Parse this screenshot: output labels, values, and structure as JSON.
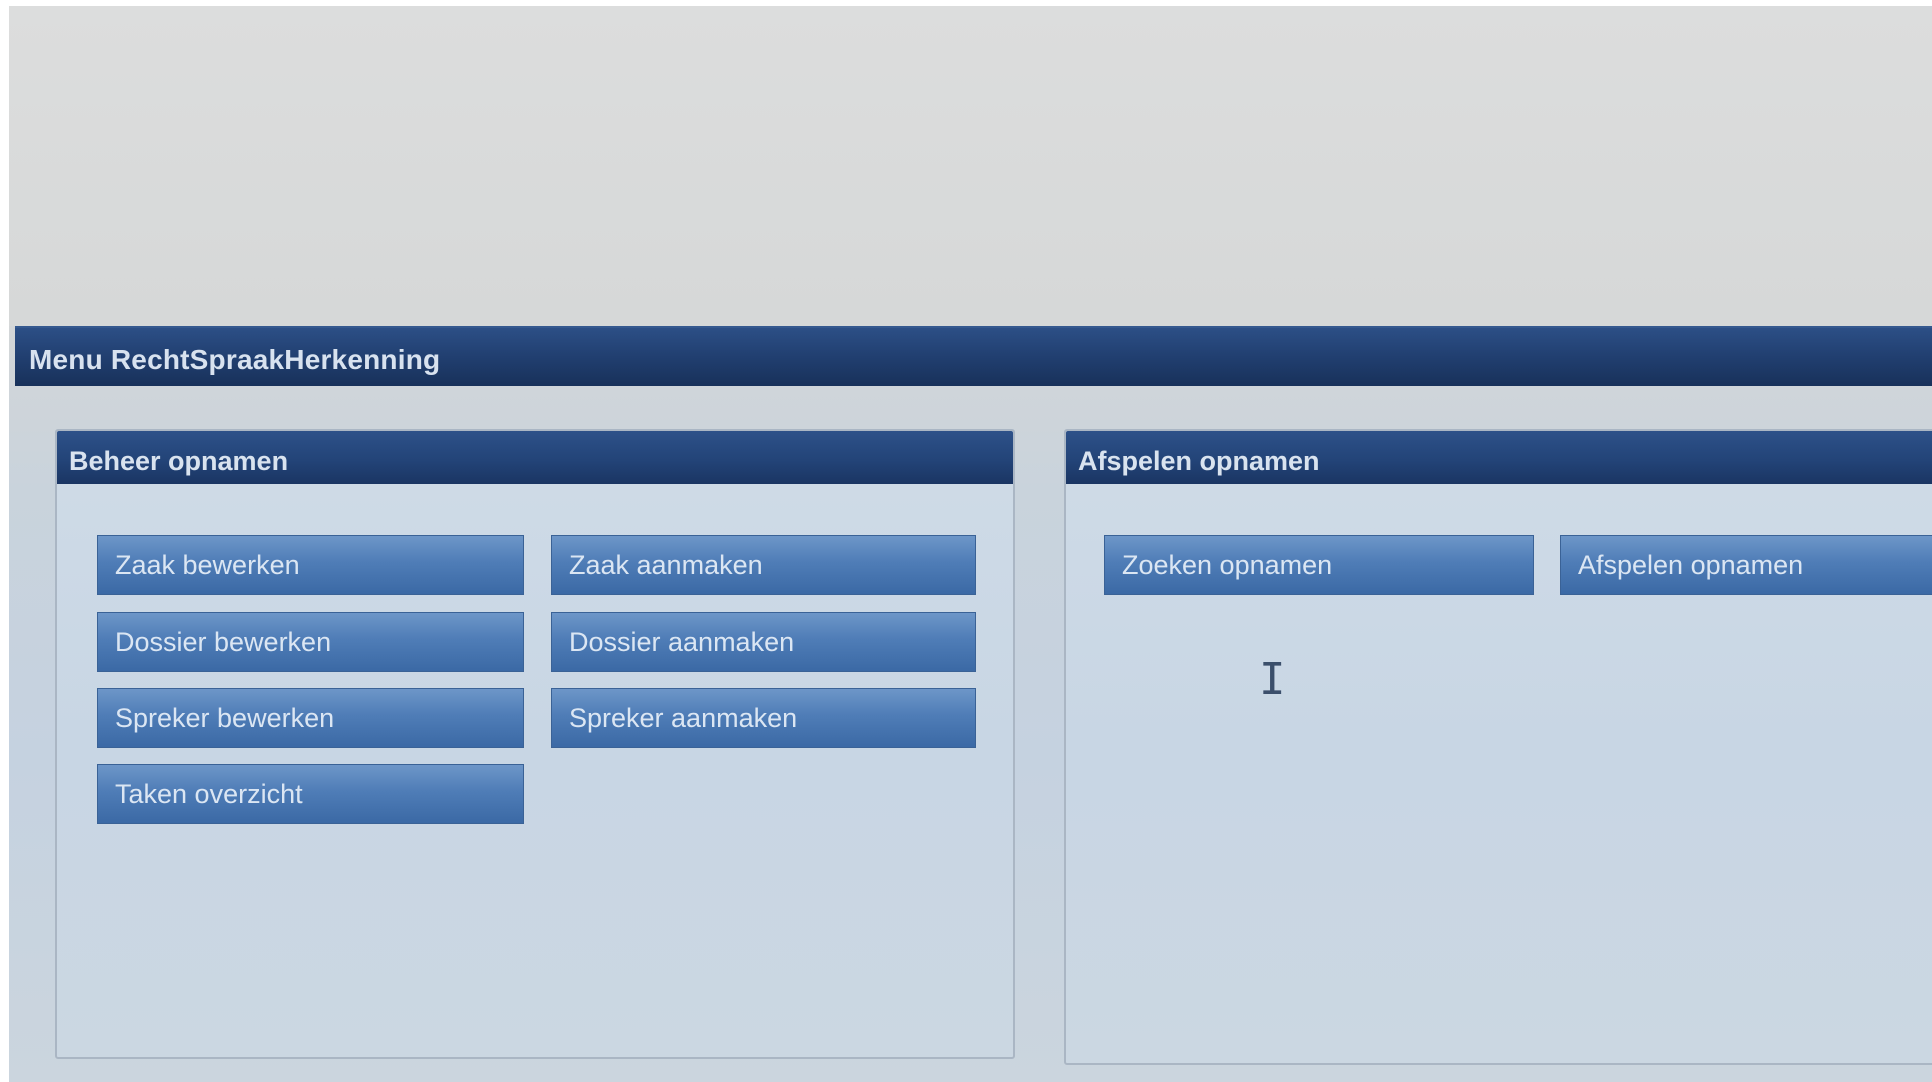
{
  "menu": {
    "title": "Menu RechtSpraakHerkenning"
  },
  "panels": {
    "beheer": {
      "title": "Beheer opnamen",
      "buttons": [
        "Zaak bewerken",
        "Zaak aanmaken",
        "Dossier bewerken",
        "Dossier aanmaken",
        "Spreker bewerken",
        "Spreker aanmaken",
        "Taken overzicht"
      ]
    },
    "afspelen": {
      "title": "Afspelen opnamen",
      "buttons": [
        "Zoeken opnamen",
        "Afspelen opnamen"
      ]
    }
  },
  "colors": {
    "header": "#213f70",
    "button": "#4f7db7",
    "panel_bg": "#cbd7e2"
  },
  "cursor": "text-cursor-icon"
}
